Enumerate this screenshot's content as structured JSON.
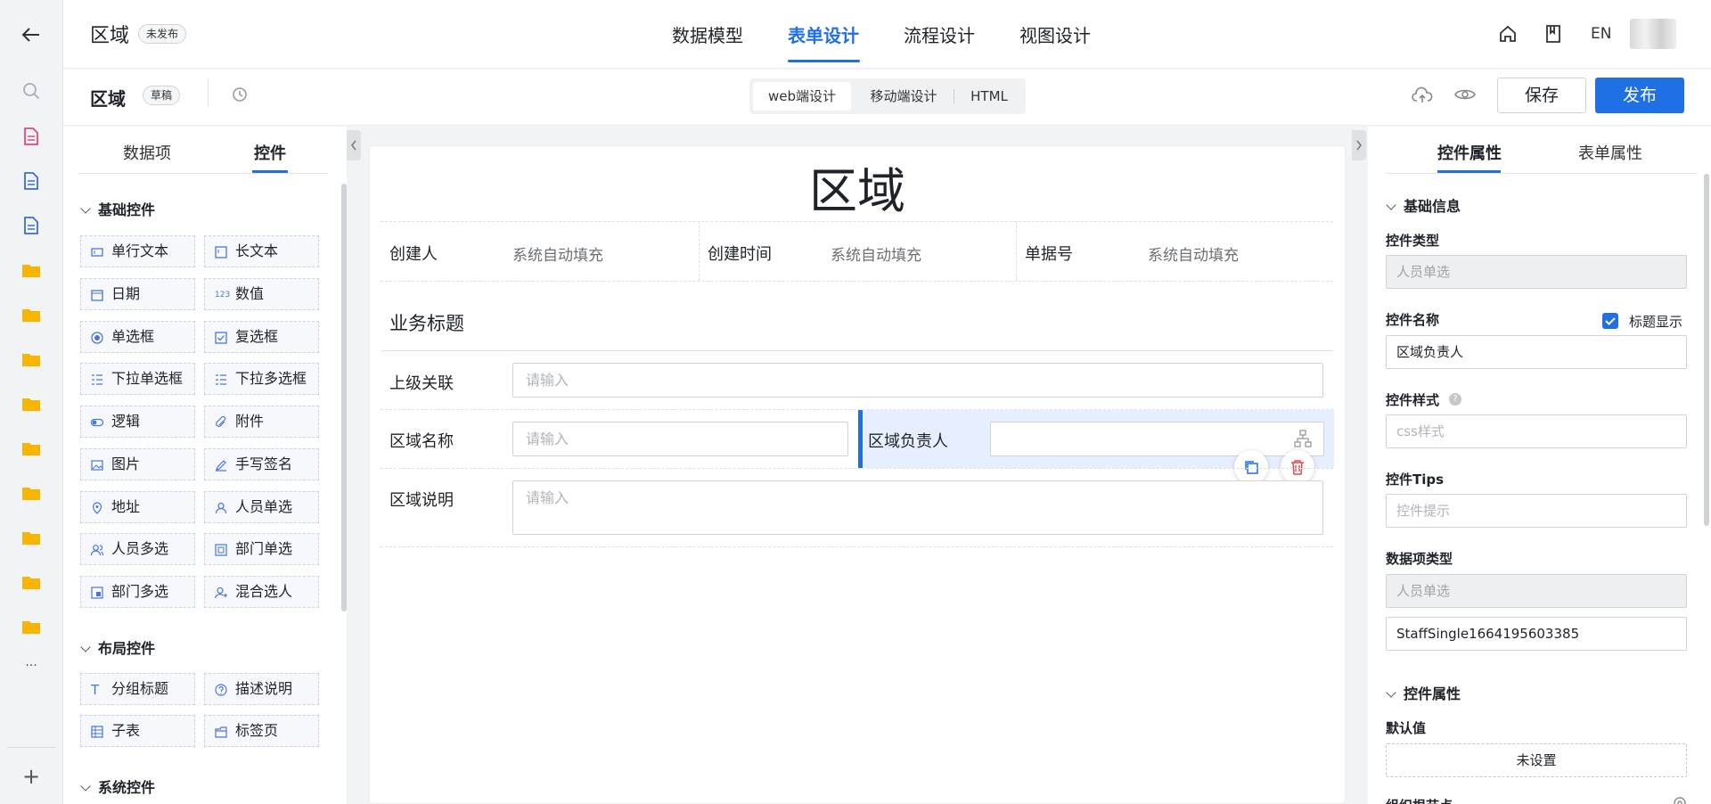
{
  "app": {
    "title": "区域",
    "status_badge": "未发布",
    "nav_tabs": [
      {
        "label": "数据模型",
        "active": false
      },
      {
        "label": "表单设计",
        "active": true
      },
      {
        "label": "流程设计",
        "active": false
      },
      {
        "label": "视图设计",
        "active": false
      }
    ],
    "lang": "EN",
    "accent_color": "#1f6fe5"
  },
  "subbar": {
    "form_name": "区域",
    "draft_badge": "草稿",
    "design_modes": [
      {
        "label": "web端设计",
        "active": true
      },
      {
        "label": "移动端设计",
        "active": false
      },
      {
        "label": "HTML",
        "active": false
      }
    ],
    "save_label": "保存",
    "publish_label": "发布"
  },
  "rail": {
    "icons": [
      "back-arrow-icon",
      "search-icon",
      "form-doc-icon",
      "doc-icon",
      "doc-icon",
      "folder-icon",
      "folder-icon",
      "folder-icon",
      "folder-icon",
      "folder-icon",
      "folder-icon",
      "folder-icon",
      "folder-icon",
      "folder-icon",
      "more-icon",
      "add-icon"
    ],
    "more": "···",
    "add": "+"
  },
  "left_panel": {
    "tabs": [
      {
        "label": "数据项",
        "active": false
      },
      {
        "label": "控件",
        "active": true
      }
    ],
    "sections": [
      {
        "title": "基础控件",
        "items": [
          "单行文本",
          "长文本",
          "日期",
          "数值",
          "单选框",
          "复选框",
          "下拉单选框",
          "下拉多选框",
          "逻辑",
          "附件",
          "图片",
          "手写签名",
          "地址",
          "人员单选",
          "人员多选",
          "部门单选",
          "部门多选",
          "混合选人"
        ]
      },
      {
        "title": "布局控件",
        "items": [
          "分组标题",
          "描述说明",
          "子表",
          "标签页"
        ]
      },
      {
        "title": "系统控件",
        "items": []
      }
    ]
  },
  "form": {
    "title": "区域",
    "system_fields": [
      {
        "label": "创建人",
        "value": "系统自动填充"
      },
      {
        "label": "创建时间",
        "value": "系统自动填充"
      },
      {
        "label": "单据号",
        "value": "系统自动填充"
      }
    ],
    "group_title": "业务标题",
    "fields": {
      "parent": {
        "label": "上级关联",
        "placeholder": "请输入"
      },
      "name": {
        "label": "区域名称",
        "placeholder": "请输入"
      },
      "owner": {
        "label": "区域负责人",
        "placeholder": ""
      },
      "desc": {
        "label": "区域说明",
        "placeholder": "请输入"
      }
    }
  },
  "right_panel": {
    "tabs": [
      {
        "label": "控件属性",
        "active": true
      },
      {
        "label": "表单属性",
        "active": false
      }
    ],
    "basic_section": "基础信息",
    "control_type_label": "控件类型",
    "control_type_value": "人员单选",
    "control_name_label": "控件名称",
    "show_title_label": "标题显示",
    "show_title_checked": true,
    "control_name_value": "区域负责人",
    "control_style_label": "控件样式",
    "control_style_placeholder": "css样式",
    "control_tips_label": "控件Tips",
    "control_tips_placeholder": "控件提示",
    "data_type_label": "数据项类型",
    "data_type_value": "人员单选",
    "data_code_value": "StaffSingle1664195603385",
    "props_section": "控件属性",
    "default_label": "默认值",
    "default_value": "未设置",
    "cut_label": "组织根节点"
  }
}
